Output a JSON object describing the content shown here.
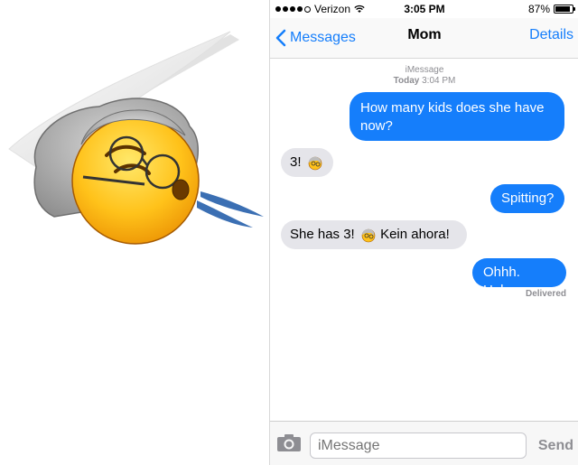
{
  "status_bar": {
    "carrier": "Verizon",
    "time": "3:05 PM",
    "battery_text": "87%",
    "battery_level": 0.87,
    "signal_bars_filled": 4,
    "signal_bars_total": 5
  },
  "nav": {
    "back_label": "Messages",
    "title": "Mom",
    "details_label": "Details"
  },
  "thread": {
    "service_label": "iMessage",
    "day_label": "Today",
    "timestamp": "3:04 PM",
    "messages": [
      {
        "direction": "out",
        "text": "How many kids does she have now?"
      },
      {
        "direction": "in",
        "text": "3!",
        "emoji": "old-lady-emoji"
      },
      {
        "direction": "out",
        "text": "Spitting?"
      },
      {
        "direction": "in",
        "text_before": "She has 3!",
        "emoji": "old-lady-emoji",
        "text_after": "Kein ahora!"
      },
      {
        "direction": "out",
        "text": "Ohhh. Haha"
      }
    ],
    "delivered_label": "Delivered"
  },
  "composer": {
    "placeholder": "iMessage",
    "send_label": "Send",
    "camera_icon": "camera-icon"
  },
  "colors": {
    "accent": "#157efb",
    "incoming_bubble": "#e5e5ea",
    "meta_text": "#8e8e93"
  },
  "illustration": {
    "subject": "old-lady-spitting-emoji"
  }
}
